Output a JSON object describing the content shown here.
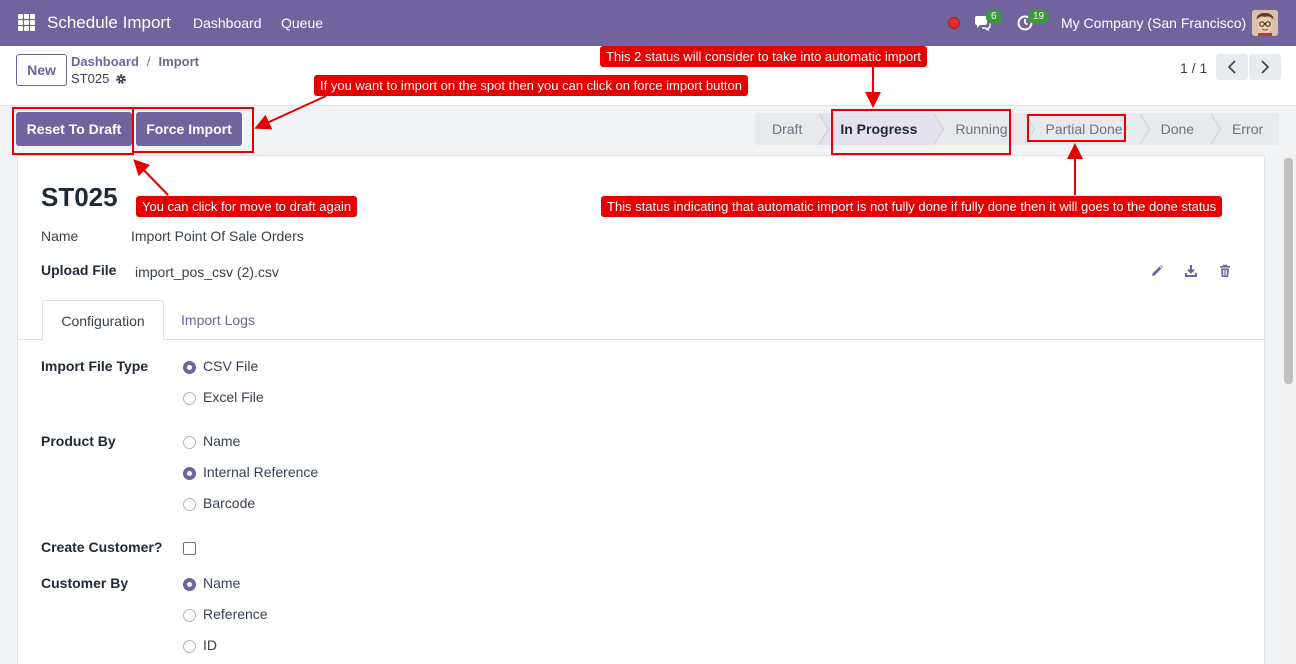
{
  "navbar": {
    "app_name": "Schedule Import",
    "links": [
      "Dashboard",
      "Queue"
    ],
    "chat_count": "6",
    "activity_count": "19",
    "company": "My Company (San Francisco)"
  },
  "control": {
    "new_label": "New",
    "breadcrumb": [
      "Dashboard",
      "Import"
    ],
    "breadcrumb_sep": "/",
    "record": "ST025",
    "pager": "1 / 1"
  },
  "actions": {
    "reset": "Reset To Draft",
    "force": "Force Import"
  },
  "statusbar": [
    "Draft",
    "In Progress",
    "Running",
    "Partial Done",
    "Done",
    "Error"
  ],
  "statusbar_active": "In Progress",
  "form": {
    "name_title": "ST025",
    "name_label": "Name",
    "name_value": "Import Point Of Sale Orders",
    "upload_label": "Upload File",
    "upload_value": "import_pos_csv (2).csv",
    "tabs": [
      "Configuration",
      "Import Logs"
    ],
    "import_file_type_label": "Import File Type",
    "import_file_type_options": [
      "CSV File",
      "Excel File"
    ],
    "product_by_label": "Product By",
    "product_by_options": [
      "Name",
      "Internal Reference",
      "Barcode"
    ],
    "create_customer_label": "Create Customer?",
    "customer_by_label": "Customer By",
    "customer_by_options": [
      "Name",
      "Reference",
      "ID"
    ]
  },
  "annotations": {
    "status_note": "This 2 status will consider to take into automatic import",
    "force_note": "If you want to import on the spot then you can click on force import button",
    "draft_note": "You can click for move to draft again",
    "partial_note": "This status indicating that automatic import is not fully done if fully done then it will goes to the done status"
  },
  "colors": {
    "brand": "#71639e",
    "annotation": "#e60000"
  }
}
